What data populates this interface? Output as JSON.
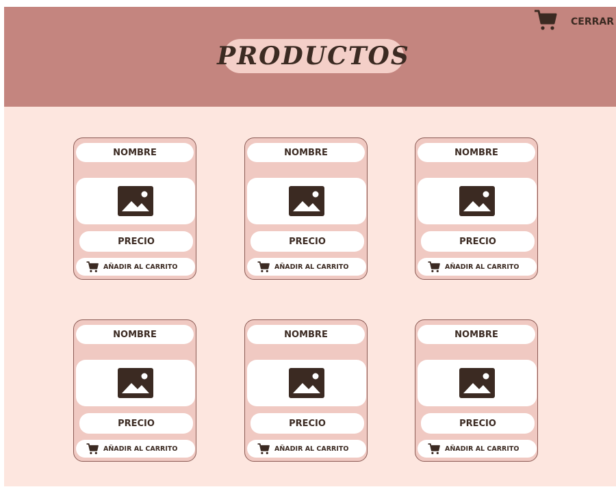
{
  "header": {
    "title": "PRODUCTOS",
    "close_label": "CERRAR",
    "cart_icon": "cart-icon"
  },
  "colors": {
    "header_bg": "#c4857f",
    "page_bg": "#fde6df",
    "card_bg": "#f0c9c2",
    "text_dark": "#3b2a22"
  },
  "products": [
    {
      "name": "NOMBRE",
      "price": "PRECIO",
      "add_label": "AÑADIR AL CARRITO",
      "image_icon": "image-placeholder-icon"
    },
    {
      "name": "NOMBRE",
      "price": "PRECIO",
      "add_label": "AÑADIR AL CARRITO",
      "image_icon": "image-placeholder-icon"
    },
    {
      "name": "NOMBRE",
      "price": "PRECIO",
      "add_label": "AÑADIR AL CARRITO",
      "image_icon": "image-placeholder-icon"
    },
    {
      "name": "NOMBRE",
      "price": "PRECIO",
      "add_label": "AÑADIR AL CARRITO",
      "image_icon": "image-placeholder-icon"
    },
    {
      "name": "NOMBRE",
      "price": "PRECIO",
      "add_label": "AÑADIR AL CARRITO",
      "image_icon": "image-placeholder-icon"
    },
    {
      "name": "NOMBRE",
      "price": "PRECIO",
      "add_label": "AÑADIR AL CARRITO",
      "image_icon": "image-placeholder-icon"
    }
  ]
}
